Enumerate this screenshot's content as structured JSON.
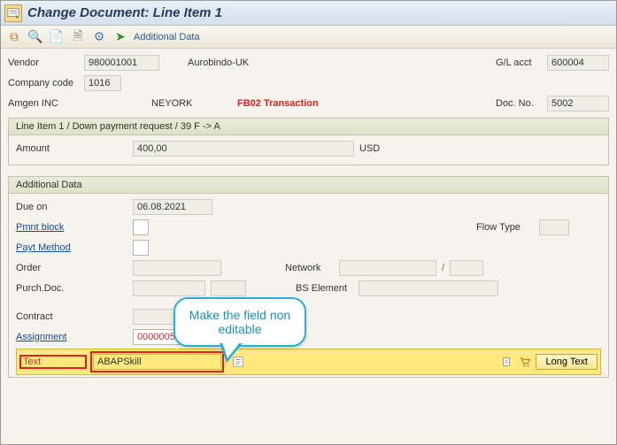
{
  "title": "Change Document: Line Item 1",
  "toolbar": {
    "additional_data": "Additional Data"
  },
  "header": {
    "vendor_label": "Vendor",
    "vendor_value": "980001001",
    "vendor_name": "Aurobindo-UK",
    "gl_acct_label": "G/L acct",
    "gl_acct_value": "600004",
    "company_code_label": "Company code",
    "company_code_value": "1016",
    "company_name": "Amgen INC",
    "city": "NEYORK",
    "transaction_note": "FB02 Transaction",
    "doc_no_label": "Doc. No.",
    "doc_no_value": "5002"
  },
  "line_item_header": "Line Item 1 / Down payment request / 39 F -> A",
  "line_item": {
    "amount_label": "Amount",
    "amount_value": "400,00",
    "currency": "USD"
  },
  "additional": {
    "header": "Additional Data",
    "due_on_label": "Due on",
    "due_on_value": "06.08.2021",
    "pmnt_block_label": "Pmnt block",
    "flow_type_label": "Flow Type",
    "payt_method_label": "Payt Method",
    "order_label": "Order",
    "network_label": "Network",
    "purch_doc_label": "Purch.Doc.",
    "wbs_label": "BS Element",
    "contract_label": "Contract",
    "assignment_label": "Assignment",
    "assignment_value": "00000050022021",
    "text_label": "Text",
    "text_value": "ABAPSkill",
    "long_text_label": "Long Text"
  },
  "callout": "Make the field non editable"
}
